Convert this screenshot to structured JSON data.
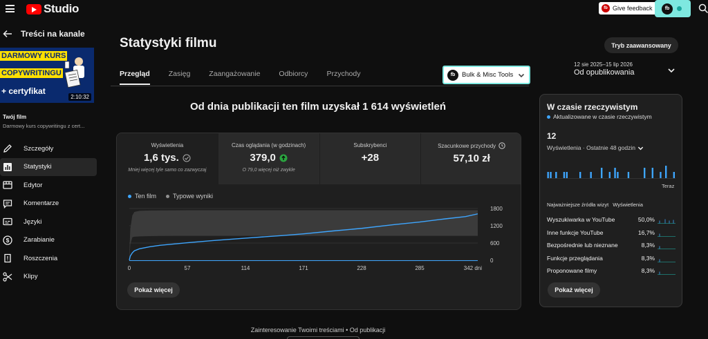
{
  "topbar": {
    "logo_text": "Studio",
    "feedback_label": "Give feedback",
    "ext_badge": "fb",
    "feedback_badge": "fb"
  },
  "sidebar": {
    "back_label": "Treści na kanale",
    "thumbnail": {
      "line1": "DARMOWY KURS",
      "line2": "COPYWRITINGU",
      "line3": "+ certyfikat",
      "duration": "2:10:32"
    },
    "your_film_label": "Twój film",
    "film_title": "Darmowy kurs copywritingu z cert...",
    "items": [
      {
        "label": "Szczegóły",
        "icon": "pencil-icon",
        "active": false
      },
      {
        "label": "Statystyki",
        "icon": "analytics-icon",
        "active": true
      },
      {
        "label": "Edytor",
        "icon": "editor-icon",
        "active": false
      },
      {
        "label": "Komentarze",
        "icon": "comments-icon",
        "active": false
      },
      {
        "label": "Języki",
        "icon": "subtitles-icon",
        "active": false
      },
      {
        "label": "Zarabianie",
        "icon": "dollar-icon",
        "active": false
      },
      {
        "label": "Roszczenia",
        "icon": "copyright-icon",
        "active": false
      },
      {
        "label": "Klipy",
        "icon": "scissors-icon",
        "active": false
      }
    ]
  },
  "main": {
    "title": "Statystyki filmu",
    "advanced_button": "Tryb zaawansowany",
    "tabs": [
      {
        "label": "Przegląd",
        "active": true
      },
      {
        "label": "Zasięg",
        "active": false
      },
      {
        "label": "Zaangażowanie",
        "active": false
      },
      {
        "label": "Odbiorcy",
        "active": false
      },
      {
        "label": "Przychody",
        "active": false
      }
    ],
    "bulk_tools": {
      "badge": "fb",
      "label": "Bulk & Misc Tools"
    },
    "date_range": "12 sie 2025–15 lip 2026",
    "date_label": "Od opublikowania",
    "headline": "Od dnia publikacji ten film uzyskał 1 614 wyświetleń",
    "metrics": [
      {
        "label": "Wyświetlenia",
        "value": "1,6 tys.",
        "sub": "Mniej więcej tyle samo co zazwyczaj",
        "indicator": "check-icon"
      },
      {
        "label": "Czas oglądania (w godzinach)",
        "value": "379,0",
        "sub": "O 79,0 więcej niż zwykle",
        "indicator": "arrow-up-icon"
      },
      {
        "label": "Subskrybenci",
        "value": "+28",
        "sub": ""
      },
      {
        "label": "Szacunkowe przychody",
        "value": "57,10 zł",
        "sub": "",
        "indicator": "clock-icon"
      }
    ],
    "show_more": "Pokaż więcej",
    "footer": "Zainteresowanie Twoimi treściami • Od publikacji"
  },
  "chart_data": {
    "type": "line",
    "series": [
      {
        "name": "Ten film",
        "color": "#3ea6ff",
        "x": [
          0,
          1,
          3,
          5,
          10,
          20,
          30,
          57,
          80,
          114,
          150,
          171,
          200,
          228,
          260,
          285,
          310,
          330,
          342
        ],
        "y": [
          5,
          150,
          260,
          330,
          400,
          470,
          520,
          610,
          680,
          770,
          860,
          920,
          1020,
          1110,
          1240,
          1330,
          1440,
          1520,
          1614
        ]
      },
      {
        "name": "Typowe wyniki",
        "color": "#909090",
        "x": [
          0,
          1,
          3,
          5,
          10,
          20,
          30,
          57,
          80,
          114,
          150,
          171,
          200,
          228,
          260,
          285,
          310,
          330,
          342
        ],
        "y": [
          180,
          1100,
          1560,
          1680,
          1720,
          1730,
          1735,
          1740,
          1740,
          1740,
          1740,
          1740,
          1740,
          1740,
          1740,
          1740,
          1740,
          1740,
          1740
        ],
        "band_low": [
          0,
          550,
          800,
          820,
          830,
          840,
          845,
          850,
          850,
          850,
          850,
          850,
          850,
          850,
          850,
          850,
          850,
          850,
          850
        ]
      }
    ],
    "x_ticks": [
      "0",
      "57",
      "114",
      "171",
      "228",
      "285",
      "342 dni"
    ],
    "x_tick_values": [
      0,
      57,
      114,
      171,
      228,
      285,
      342
    ],
    "y_ticks": [
      "0",
      "600",
      "1200",
      "1800"
    ],
    "y_tick_values": [
      0,
      600,
      1200,
      1800
    ],
    "xlim": [
      0,
      342
    ],
    "ylim": [
      0,
      1800
    ],
    "legend_position": "top-left"
  },
  "realtime": {
    "title": "W czasie rzeczywistym",
    "subtitle": "Aktualizowane w czasie rzeczywistym",
    "count": "12",
    "metric_label": "Wyświetlenia · Ostatnie 48 godzin",
    "now_label": "Teraz",
    "bars": [
      1,
      1,
      0,
      1,
      0,
      0,
      1,
      1,
      0,
      0,
      0,
      0,
      1,
      0,
      0,
      0,
      1,
      0,
      0,
      0,
      1,
      0,
      0,
      1,
      0,
      1,
      1,
      0,
      0,
      0,
      1,
      0,
      0,
      0,
      0,
      0,
      1,
      0,
      0,
      1,
      0,
      0,
      1,
      0,
      2,
      0,
      0,
      1
    ],
    "bar_highlights": [
      20,
      25,
      36,
      39
    ],
    "sources_header": [
      "Najważniejsze źródła wizyt",
      "Wyświetlenia"
    ],
    "sources": [
      {
        "name": "Wyszukiwarka w YouTube",
        "value": "50,0%"
      },
      {
        "name": "Inne funkcje YouTube",
        "value": "16,7%"
      },
      {
        "name": "Bezpośrednie lub nieznane",
        "value": "8,3%"
      },
      {
        "name": "Funkcje przeglądania",
        "value": "8,3%"
      },
      {
        "name": "Proponowane filmy",
        "value": "8,3%"
      }
    ],
    "show_more": "Pokaż więcej"
  }
}
